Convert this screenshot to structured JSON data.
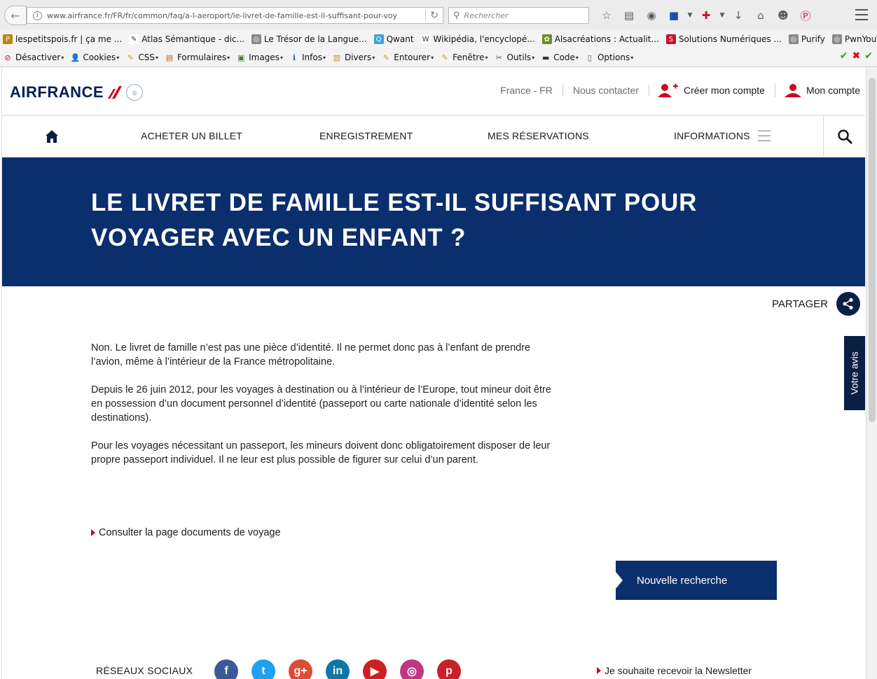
{
  "browser": {
    "url": "www.airfrance.fr/FR/fr/common/faq/a-l-aeroport/le-livret-de-famille-est-il-suffisant-pour-voy",
    "search_placeholder": "Rechercher",
    "bookmarks": [
      {
        "label": "lespetitspois.fr | ça me ...",
        "color": "#b8860b",
        "glyph": "P"
      },
      {
        "label": "Atlas Sémantique - dic...",
        "color": "#ffffff",
        "glyph": "✎"
      },
      {
        "label": "Le Trésor de la Langue...",
        "color": "#888888",
        "glyph": "◎"
      },
      {
        "label": "Qwant",
        "color": "#3aa3d8",
        "glyph": "Q"
      },
      {
        "label": "Wikipédia, l'encyclopé...",
        "color": "#ffffff",
        "glyph": "W"
      },
      {
        "label": "Alsacréations : Actualit...",
        "color": "#6b8e23",
        "glyph": "✿"
      },
      {
        "label": "Solutions Numériques ...",
        "color": "#c8102e",
        "glyph": "S"
      },
      {
        "label": "Purify",
        "color": "#888888",
        "glyph": "◎"
      },
      {
        "label": "PwnYouTube",
        "color": "#888888",
        "glyph": "◎"
      }
    ],
    "dev_tools": [
      {
        "label": "Désactiver",
        "glyph": "⊘",
        "color": "#c8102e"
      },
      {
        "label": "Cookies",
        "glyph": "👤",
        "color": "#333333"
      },
      {
        "label": "CSS",
        "glyph": "✎",
        "color": "#c9a227"
      },
      {
        "label": "Formulaires",
        "glyph": "▤",
        "color": "#b5651d"
      },
      {
        "label": "Images",
        "glyph": "▣",
        "color": "#4a7a3a"
      },
      {
        "label": "Infos",
        "glyph": "ℹ",
        "color": "#1e5aa8"
      },
      {
        "label": "Divers",
        "glyph": "▥",
        "color": "#c78a2c"
      },
      {
        "label": "Entourer",
        "glyph": "✎",
        "color": "#c9a227"
      },
      {
        "label": "Fenêtre",
        "glyph": "✎",
        "color": "#c9a227"
      },
      {
        "label": "Outils",
        "glyph": "✂",
        "color": "#555555"
      },
      {
        "label": "Code",
        "glyph": "▬",
        "color": "#333333"
      },
      {
        "label": "Options",
        "glyph": "▯",
        "color": "#555555"
      }
    ]
  },
  "header": {
    "logo_text": "AIRFRANCE",
    "locale": "France - FR",
    "contact": "Nous contacter",
    "create_account": "Créer mon compte",
    "my_account": "Mon compte"
  },
  "nav": {
    "items": [
      "ACHETER UN BILLET",
      "ENREGISTREMENT",
      "MES RÉSERVATIONS",
      "INFORMATIONS"
    ]
  },
  "hero": {
    "title": "LE LIVRET DE FAMILLE EST-IL SUFFISANT POUR VOYAGER AVEC UN ENFANT ?"
  },
  "share_label": "PARTAGER",
  "article": {
    "paragraphs": [
      "Non. Le livret de famille n’est pas une pièce d’identité. Il ne permet donc pas à l’enfant de prendre l’avion, même à l’intérieur de la France métropolitaine.",
      "Depuis le 26 juin 2012, pour les voyages à destination ou à l’intérieur de l’Europe, tout mineur doit être en possession d’un document personnel d’identité (passeport ou carte nationale d’identité selon les destinations).",
      "Pour les voyages nécessitant un passeport, les mineurs doivent donc obligatoirement disposer de leur propre passeport individuel. Il ne leur est plus possible de figurer sur celui d’un parent."
    ]
  },
  "doc_link": "Consulter la page documents de voyage",
  "new_search": "Nouvelle recherche",
  "feedback": "Votre avis",
  "footer": {
    "social_label": "RÉSEAUX SOCIAUX",
    "networks": [
      {
        "name": "facebook-icon",
        "glyph": "f",
        "color": "#3b5998"
      },
      {
        "name": "twitter-icon",
        "glyph": "t",
        "color": "#1da1f2"
      },
      {
        "name": "google-plus-icon",
        "glyph": "g+",
        "color": "#dd4b39"
      },
      {
        "name": "linkedin-icon",
        "glyph": "in",
        "color": "#0e76a8"
      },
      {
        "name": "youtube-icon",
        "glyph": "▶",
        "color": "#cd201f"
      },
      {
        "name": "instagram-icon",
        "glyph": "◎",
        "color": "#c13584"
      },
      {
        "name": "pinterest-icon",
        "glyph": "p",
        "color": "#cb2027"
      }
    ],
    "newsletter": "Je souhaite recevoir la Newsletter"
  }
}
